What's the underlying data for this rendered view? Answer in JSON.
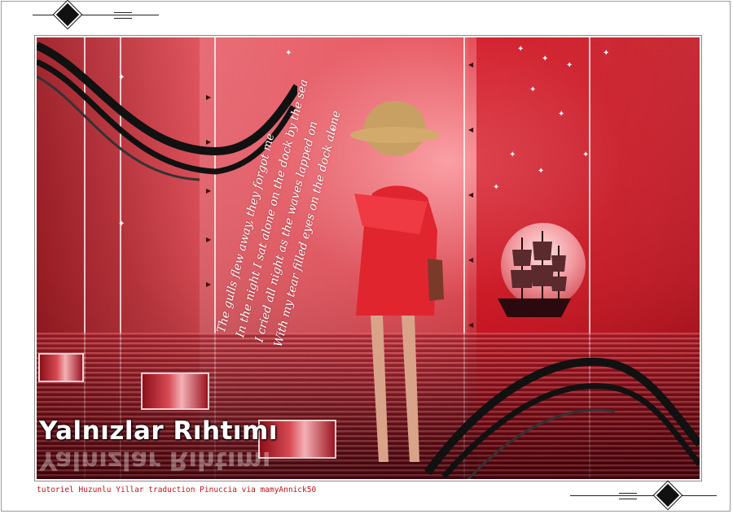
{
  "artwork": {
    "title": "Yalnızlar Rıhtımı",
    "lyrics": [
      "The gulls flew away, they forgot me",
      "In the night I sat alone on the dock by the sea",
      "I cried all night as the waves lapped on",
      "With my tear filled eyes on the dock alone"
    ]
  },
  "credit": "tutoriel Huzunlu Yillar traduction Pinuccia via mamyAnnick50",
  "colors": {
    "accent_red": "#c72f3c",
    "credit_red": "#c1121c",
    "frame_border": "#ffffff",
    "swoosh": "#111111"
  },
  "icons": [
    "diamond-ornament-icon",
    "ship-icon",
    "moon-icon",
    "sparkle-star-icon"
  ]
}
